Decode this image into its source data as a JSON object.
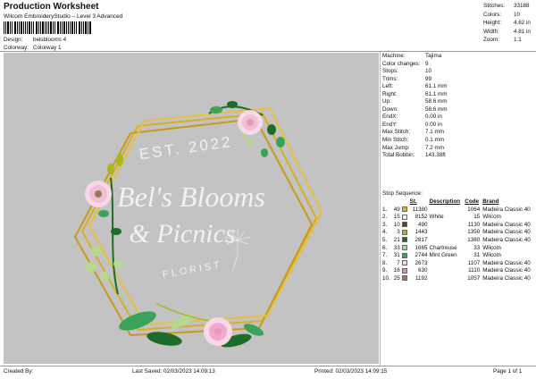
{
  "header": {
    "title": "Production Worksheet",
    "subtitle": "Wilcom EmbroideryStudio – Level 3 Advanced"
  },
  "meta": [
    {
      "key": "Design:",
      "value": "belsblooms 4"
    },
    {
      "key": "Colorway:",
      "value": "Colorway 1"
    }
  ],
  "stats": [
    {
      "key": "Stitches:",
      "value": "33188"
    },
    {
      "key": "Colors:",
      "value": "10"
    },
    {
      "key": "Height:",
      "value": "4.62 in"
    },
    {
      "key": "Width:",
      "value": "4.81 in"
    },
    {
      "key": "Zoom:",
      "value": "1:1"
    }
  ],
  "design": {
    "line1": "Bel's Blooms",
    "line2": "& Picnics",
    "arc_top": "EST. 2022",
    "arc_bottom": "FLORIST"
  },
  "machine_info": [
    {
      "key": "Machine:",
      "value": "Tajima"
    },
    {
      "key": "Color changes:",
      "value": "9"
    },
    {
      "key": "Stops:",
      "value": "10"
    },
    {
      "key": "Trims:",
      "value": "99"
    },
    {
      "key": "Left:",
      "value": "61.1 mm"
    },
    {
      "key": "Right:",
      "value": "61.1 mm"
    },
    {
      "key": "Up:",
      "value": "58.6 mm"
    },
    {
      "key": "Down:",
      "value": "58.6 mm"
    },
    {
      "key": "EndX:",
      "value": "0.00 in"
    },
    {
      "key": "EndY:",
      "value": "0.00 in"
    },
    {
      "key": "Max Stitch:",
      "value": "7.1 mm"
    },
    {
      "key": "Min Stitch:",
      "value": "0.1 mm"
    },
    {
      "key": "Max Jump:",
      "value": "7.2 mm"
    },
    {
      "key": "Total Bobbin:",
      "value": "143.38ft"
    }
  ],
  "stop_sequence": {
    "label": "Stop Sequence:",
    "headers": {
      "st": "St.",
      "description": "Description",
      "code": "Code",
      "brand": "Brand"
    },
    "rows": [
      {
        "idx": "1.",
        "stop": "49",
        "color": "#e2b21e",
        "st": "11380",
        "description": "",
        "code": "1064",
        "brand": "Madeira Classic 40"
      },
      {
        "idx": "2.",
        "stop": "15",
        "color": "#f2f2f2",
        "st": "8152",
        "description": "White",
        "code": "15",
        "brand": "Wilcom"
      },
      {
        "idx": "3.",
        "stop": "10",
        "color": "#6b3a1e",
        "st": "490",
        "description": "",
        "code": "1130",
        "brand": "Madeira Classic 40"
      },
      {
        "idx": "4.",
        "stop": "3",
        "color": "#a8b81e",
        "st": "1443",
        "description": "",
        "code": "1350",
        "brand": "Madeira Classic 40"
      },
      {
        "idx": "5.",
        "stop": "21",
        "color": "#1e6b2a",
        "st": "2817",
        "description": "",
        "code": "1380",
        "brand": "Madeira Classic 40"
      },
      {
        "idx": "6.",
        "stop": "33",
        "color": "#b6d890",
        "st": "1665",
        "description": "Chartreuse",
        "code": "33",
        "brand": "Wilcom"
      },
      {
        "idx": "7.",
        "stop": "31",
        "color": "#3aa25a",
        "st": "2744",
        "description": "Mint Green",
        "code": "31",
        "brand": "Wilcom"
      },
      {
        "idx": "8.",
        "stop": "7",
        "color": "#f8d8e8",
        "st": "2673",
        "description": "",
        "code": "1107",
        "brand": "Madeira Classic 40"
      },
      {
        "idx": "9.",
        "stop": "16",
        "color": "#f080b8",
        "st": "630",
        "description": "",
        "code": "1110",
        "brand": "Madeira Classic 40"
      },
      {
        "idx": "10.",
        "stop": "25",
        "color": "#9a7a5e",
        "st": "1192",
        "description": "",
        "code": "1057",
        "brand": "Madeira Classic 40"
      }
    ]
  },
  "footer": {
    "created_by": "Created By:",
    "last_saved": "Last Saved: 02/03/2023 14:09:13",
    "printed": "Printed: 02/03/2023 14:09:15",
    "page": "Page 1 of 1"
  }
}
